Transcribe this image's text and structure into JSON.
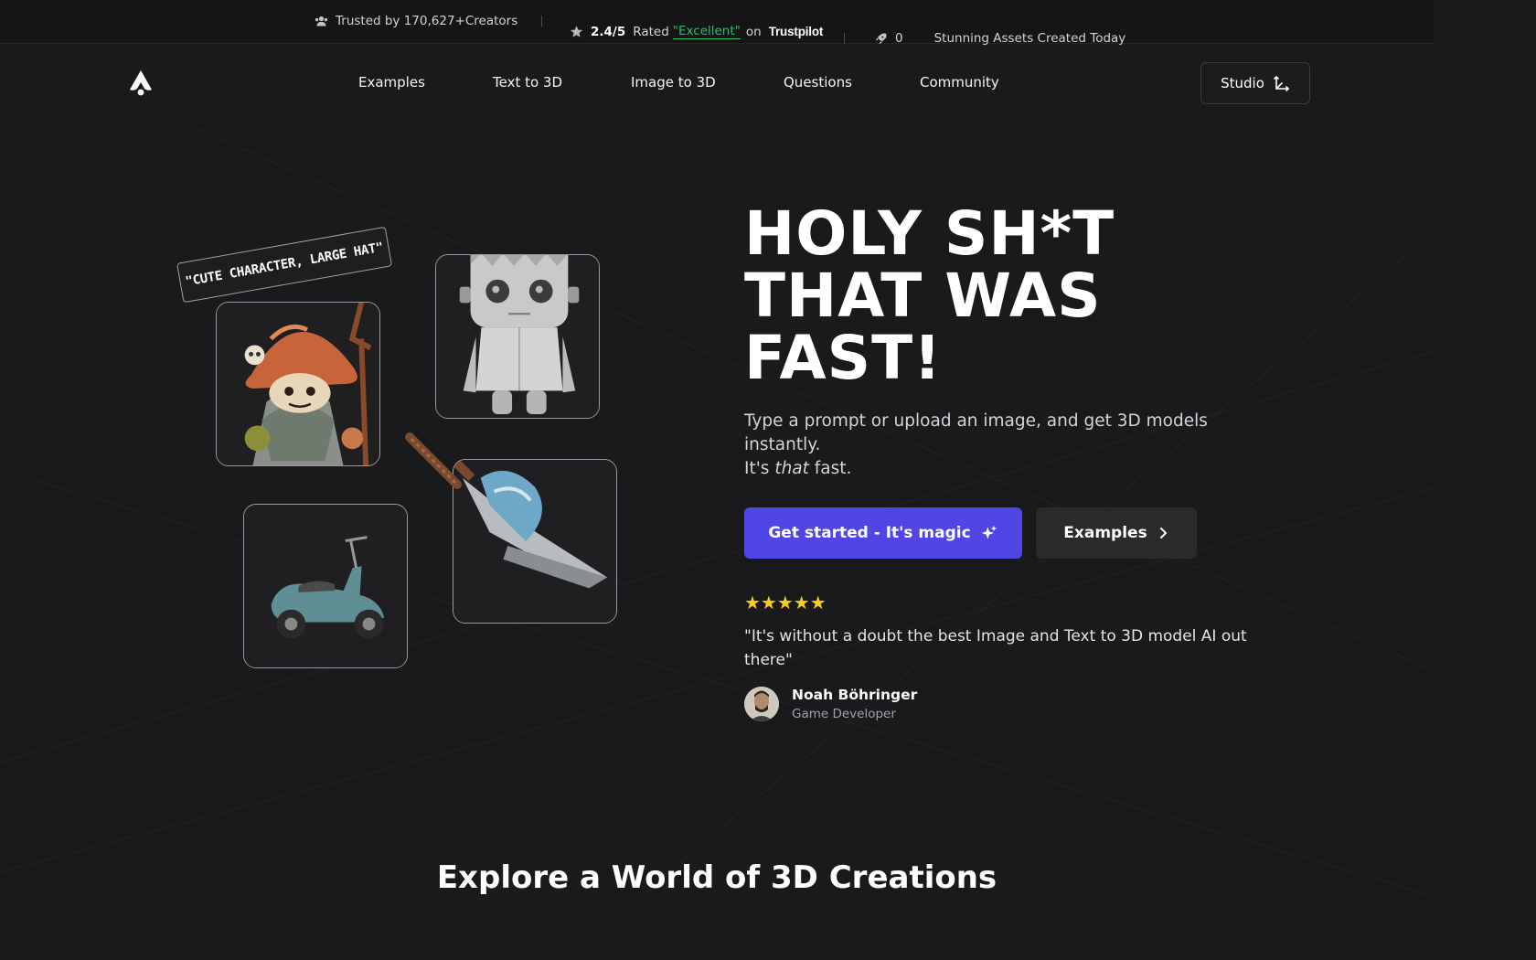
{
  "topbar": {
    "trusted_text": "Trusted by 170,627+Creators",
    "rating": "2.4/5",
    "rated_label": "Rated",
    "rated_quality": "\"Excellent\"",
    "rated_on": "on",
    "trustpilot": "Trustpilot",
    "assets_count": "0",
    "assets_text": "Stunning Assets Created Today"
  },
  "nav": {
    "links": [
      "Examples",
      "Text to 3D",
      "Image to 3D",
      "Questions",
      "Community"
    ],
    "studio_label": "Studio"
  },
  "showcase": {
    "prompt_tag": "\"CUTE CHARACTER, LARGE HAT\""
  },
  "hero": {
    "title_line1": "HOLY SH*T",
    "title_line2": "THAT WAS",
    "title_line3": "FAST!",
    "subtitle": "Type a prompt or upload an image, and get 3D models instantly.",
    "subtitle2_pre": "It's ",
    "subtitle2_em": "that",
    "subtitle2_post": " fast.",
    "cta_primary": "Get started - It's magic",
    "cta_secondary": "Examples"
  },
  "testimonial": {
    "stars": "★★★★★",
    "quote": "\"It's without a doubt the best Image and Text to 3D model AI out there\"",
    "author_name": "Noah Böhringer",
    "author_role": "Game Developer"
  },
  "section": {
    "title": "Explore a World of 3D Creations"
  },
  "colors": {
    "background": "#1a1a1c",
    "accent": "#4f46e5",
    "trustpilot_green": "#22c55e",
    "stars": "#facc15"
  }
}
